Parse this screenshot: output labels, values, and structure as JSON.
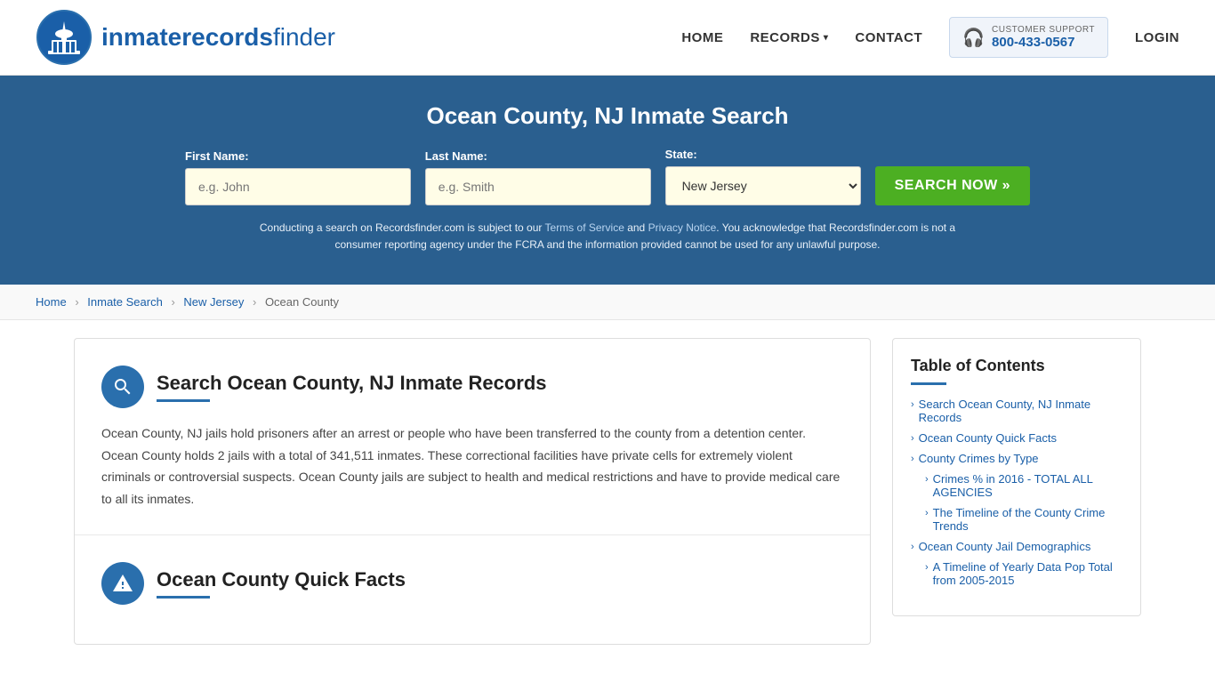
{
  "site": {
    "logo_text_normal": "inmaterecords",
    "logo_text_bold": "finder"
  },
  "nav": {
    "home_label": "HOME",
    "records_label": "RECORDS",
    "contact_label": "CONTACT",
    "login_label": "LOGIN",
    "support_label": "CUSTOMER SUPPORT",
    "support_number": "800-433-0567"
  },
  "hero": {
    "title": "Ocean County, NJ Inmate Search",
    "first_name_label": "First Name:",
    "first_name_placeholder": "e.g. John",
    "last_name_label": "Last Name:",
    "last_name_placeholder": "e.g. Smith",
    "state_label": "State:",
    "state_value": "New Jersey",
    "search_button": "SEARCH NOW »",
    "disclaimer": "Conducting a search on Recordsfinder.com is subject to our Terms of Service and Privacy Notice. You acknowledge that Recordsfinder.com is not a consumer reporting agency under the FCRA and the information provided cannot be used for any unlawful purpose."
  },
  "breadcrumb": {
    "home": "Home",
    "inmate_search": "Inmate Search",
    "new_jersey": "New Jersey",
    "ocean_county": "Ocean County"
  },
  "section1": {
    "title": "Search Ocean County, NJ Inmate Records",
    "body": "Ocean County, NJ jails hold prisoners after an arrest or people who have been transferred to the county from a detention center. Ocean County holds 2 jails with a total of 341,511 inmates. These correctional facilities have private cells for extremely violent criminals or controversial suspects. Ocean County jails are subject to health and medical restrictions and have to provide medical care to all its inmates."
  },
  "section2": {
    "title": "Ocean County Quick Facts"
  },
  "toc": {
    "title": "Table of Contents",
    "items": [
      {
        "label": "Search Ocean County, NJ Inmate Records",
        "sub": false
      },
      {
        "label": "Ocean County Quick Facts",
        "sub": false
      },
      {
        "label": "County Crimes by Type",
        "sub": false
      },
      {
        "label": "Crimes % in 2016 - TOTAL ALL AGENCIES",
        "sub": true
      },
      {
        "label": "The Timeline of the County Crime Trends",
        "sub": true
      },
      {
        "label": "Ocean County Jail Demographics",
        "sub": false
      },
      {
        "label": "A Timeline of Yearly Data Pop Total from 2005-2015",
        "sub": true
      }
    ]
  }
}
